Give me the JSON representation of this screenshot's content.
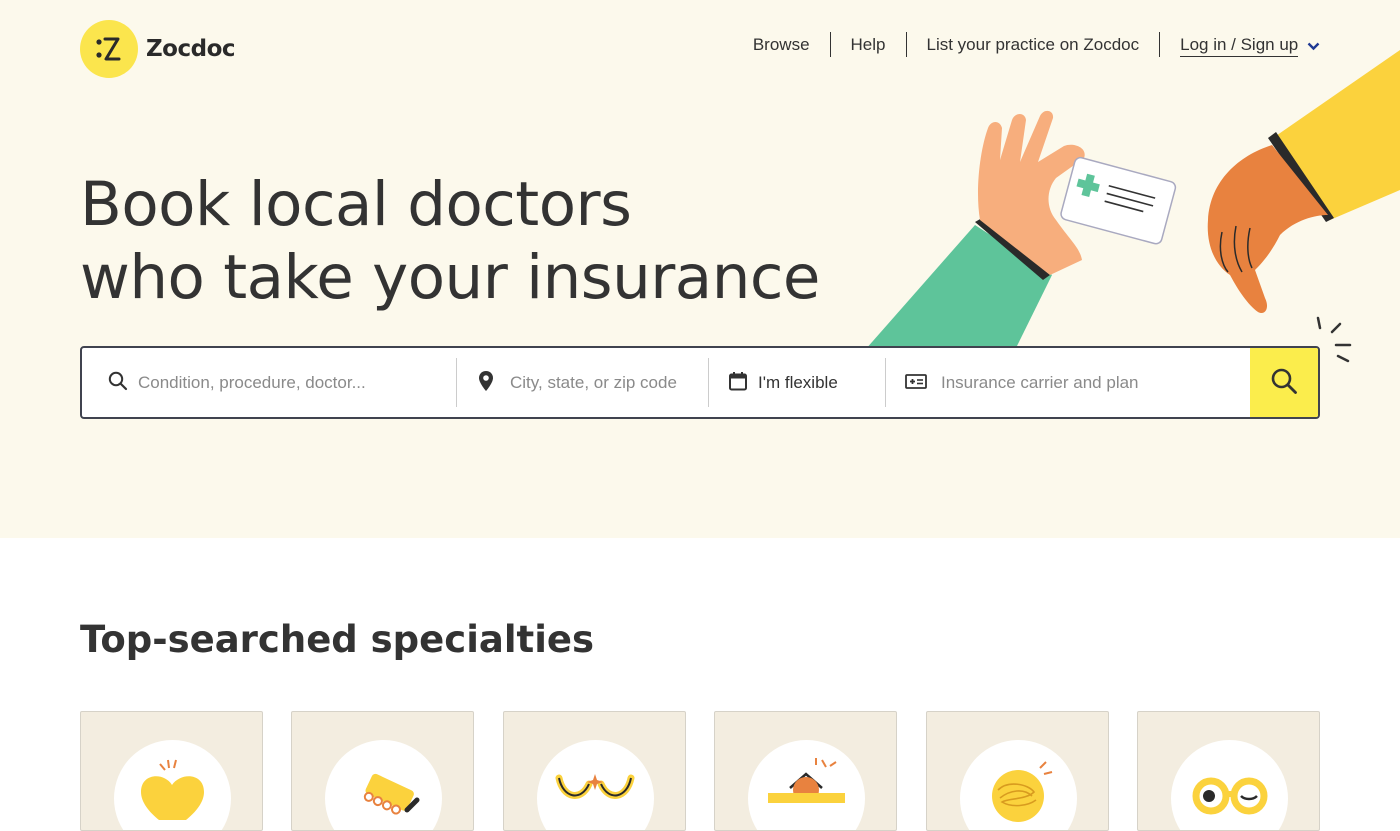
{
  "brand": {
    "name": "Zocdoc"
  },
  "nav": {
    "browse": "Browse",
    "help": "Help",
    "list_practice": "List your practice on Zocdoc",
    "login": "Log in / Sign up"
  },
  "hero": {
    "headline_line1": "Book local doctors",
    "headline_line2": "who take your insurance"
  },
  "search": {
    "condition_placeholder": "Condition, procedure, doctor...",
    "location_placeholder": "City, state, or zip code",
    "date_label": "I'm flexible",
    "insurance_placeholder": "Insurance carrier and plan"
  },
  "specialties": {
    "title": "Top-searched specialties",
    "cards": [
      {
        "icon": "heart-icon"
      },
      {
        "icon": "teeth-icon"
      },
      {
        "icon": "eyes-icon"
      },
      {
        "icon": "lamp-icon"
      },
      {
        "icon": "scribble-icon"
      },
      {
        "icon": "glasses-icon"
      }
    ]
  },
  "colors": {
    "hero_bg": "#fcf9ec",
    "brand_yellow": "#fbe54d",
    "text": "#333333",
    "card_bg": "#f3ede0"
  }
}
